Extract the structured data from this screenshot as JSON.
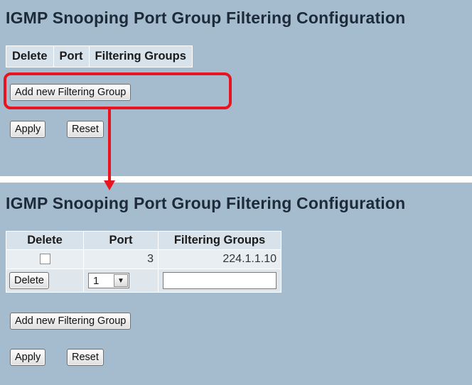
{
  "top_panel": {
    "title": "IGMP Snooping Port Group Filtering Configuration",
    "columns": [
      "Delete",
      "Port",
      "Filtering Groups"
    ],
    "add_button": "Add new Filtering Group",
    "apply_button": "Apply",
    "reset_button": "Reset"
  },
  "bottom_panel": {
    "title": "IGMP Snooping Port Group Filtering Configuration",
    "columns": [
      "Delete",
      "Port",
      "Filtering Groups"
    ],
    "rows": [
      {
        "delete_checked": false,
        "port": "3",
        "filtering_group": "224.1.1.10"
      }
    ],
    "new_row": {
      "delete_button": "Delete",
      "port_selected": "1",
      "filtering_group_value": ""
    },
    "add_button": "Add new Filtering Group",
    "apply_button": "Apply",
    "reset_button": "Reset"
  },
  "annotation": {
    "color": "#e8141f"
  }
}
